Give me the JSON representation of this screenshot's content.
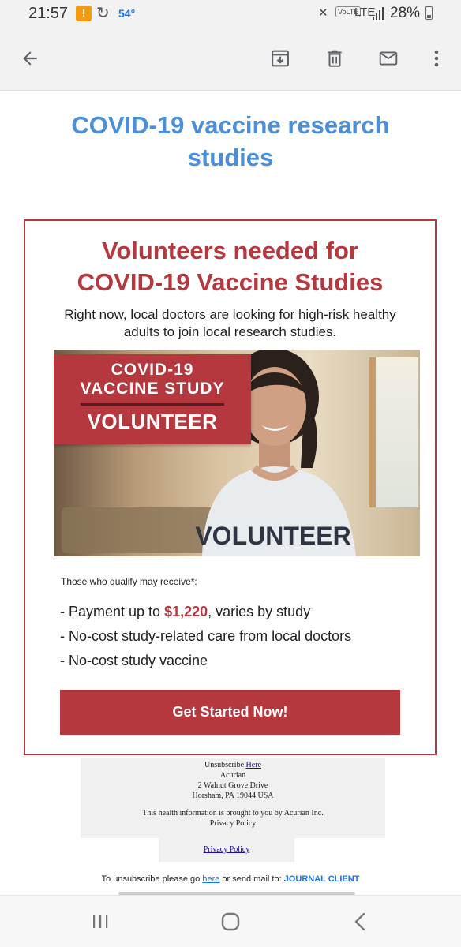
{
  "status_bar": {
    "time": "21:57",
    "temperature": "54°",
    "network": "LTE",
    "volte": "VoLTE",
    "battery": "28%"
  },
  "app_bar": {
    "icons": [
      "back-arrow-icon",
      "archive-icon",
      "delete-icon",
      "mark-unread-icon",
      "more-vert-icon"
    ]
  },
  "email": {
    "subject": "COVID-19 vaccine research studies",
    "card": {
      "heading_line1": "Volunteers needed for",
      "heading_line2": "COVID-19 Vaccine Studies",
      "intro": "Right now, local doctors are looking for high-risk healthy adults to join local research studies.",
      "banner_line1": "COVID-19",
      "banner_line2": "VACCINE STUDY",
      "banner_line3": "VOLUNTEER",
      "shirt_text": "VOLUNTEER",
      "qualify_text": "Those who qualify may receive*:",
      "benefit1_prefix": "- Payment up to ",
      "benefit1_amount": "$1,220",
      "benefit1_suffix": ", varies by study",
      "benefit2": "- No-cost study-related care from local doctors",
      "benefit3": "- No-cost study vaccine",
      "cta_label": "Get Started Now!"
    },
    "footer": {
      "unsubscribe_prefix": "Unsubscribe ",
      "unsubscribe_link": "Here",
      "company": "Acurian",
      "address1": "2 Walnut Grove Drive",
      "address2": "Horsham, PA 19044 USA",
      "health_info": "This health information is brought to you by Acurian Inc.",
      "privacy_text": "Privacy Policy",
      "privacy_link": "Privacy Policy",
      "unsub_line_prefix": "To unsubscribe please go ",
      "unsub_line_link": "here",
      "unsub_line_mid": " or send mail to: ",
      "unsub_line_journal": "JOURNAL CLIENT"
    }
  },
  "colors": {
    "accent_red": "#b5383f",
    "subject_blue": "#4a8fd8"
  }
}
